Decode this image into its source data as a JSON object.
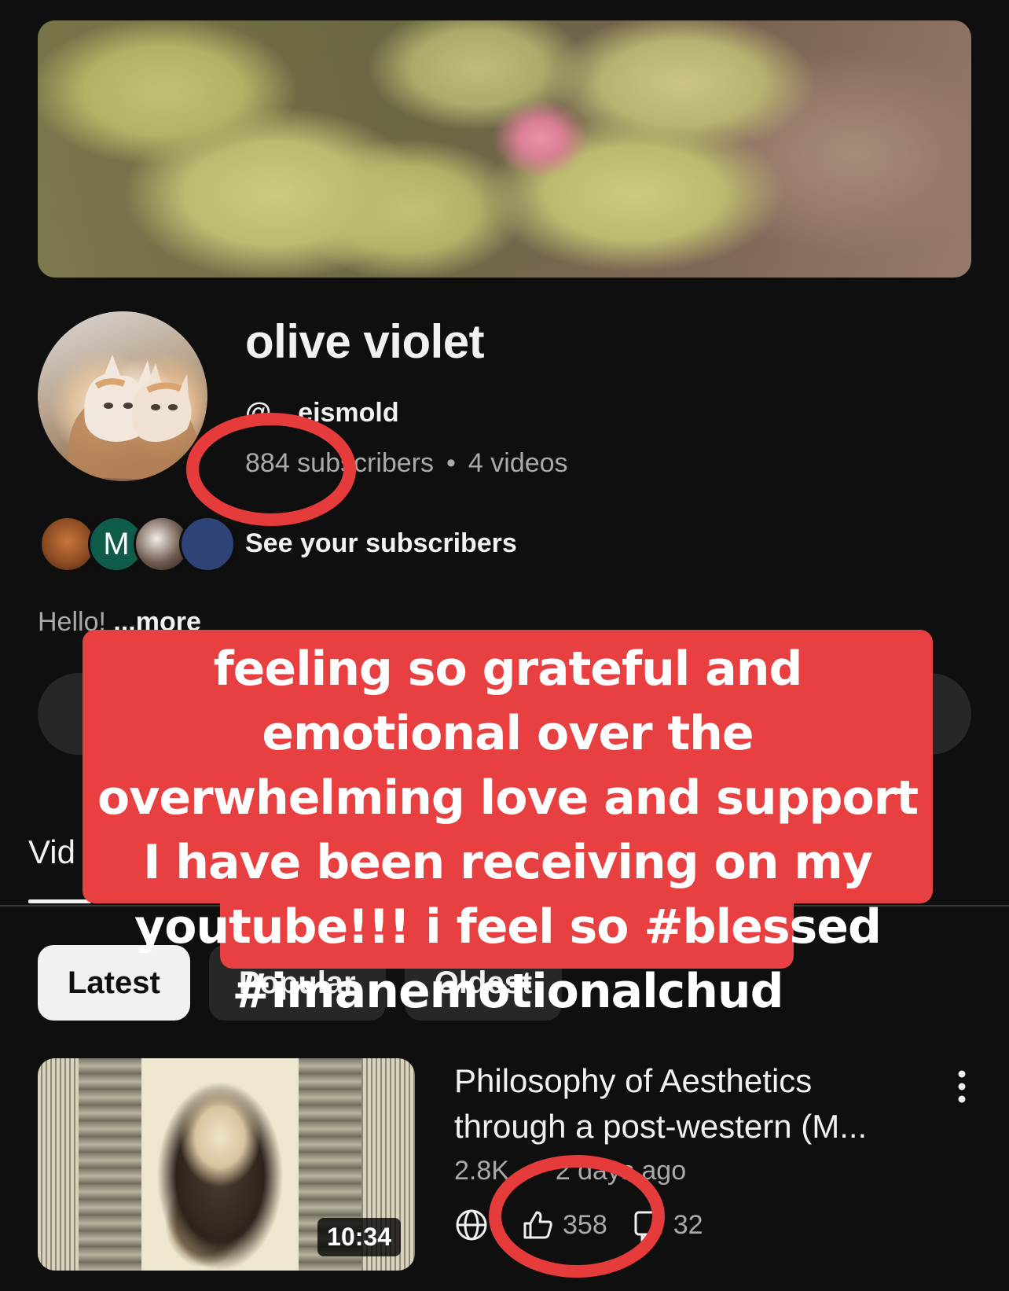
{
  "channel": {
    "name": "olive violet",
    "handle": "@…eismold",
    "subscribers": "884 subscribers",
    "videos": "4 videos",
    "separator": "•",
    "see_subscribers": "See your subscribers",
    "subscriber_avatar_letter": "M",
    "bio": "Hello!",
    "bio_more": "...more"
  },
  "tabs": {
    "videos_label": "Vid"
  },
  "chips": [
    {
      "label": "Latest",
      "active": true
    },
    {
      "label": "Popular",
      "active": false
    },
    {
      "label": "Oldest",
      "active": false
    }
  ],
  "video": {
    "title": "Philosophy of Aesthetics through a post-western (M...",
    "views": "2.8K",
    "separator": "•",
    "age": "2 days ago",
    "duration": "10:34",
    "visibility_icon": "globe-icon",
    "likes": "358",
    "comments": "32"
  },
  "overlay": {
    "caption": "feeling so grateful and emotional over the overwhelming love and support I have been receiving on my youtube!!! i feel so #blessed #imanemotionalchud",
    "circle_color": "#e53b3b",
    "caption_bg": "#e84040"
  },
  "colors": {
    "background": "#0f0f0f",
    "text_primary": "#f1f1f1",
    "text_secondary": "#aaaaaa",
    "chip_bg": "#272727"
  }
}
